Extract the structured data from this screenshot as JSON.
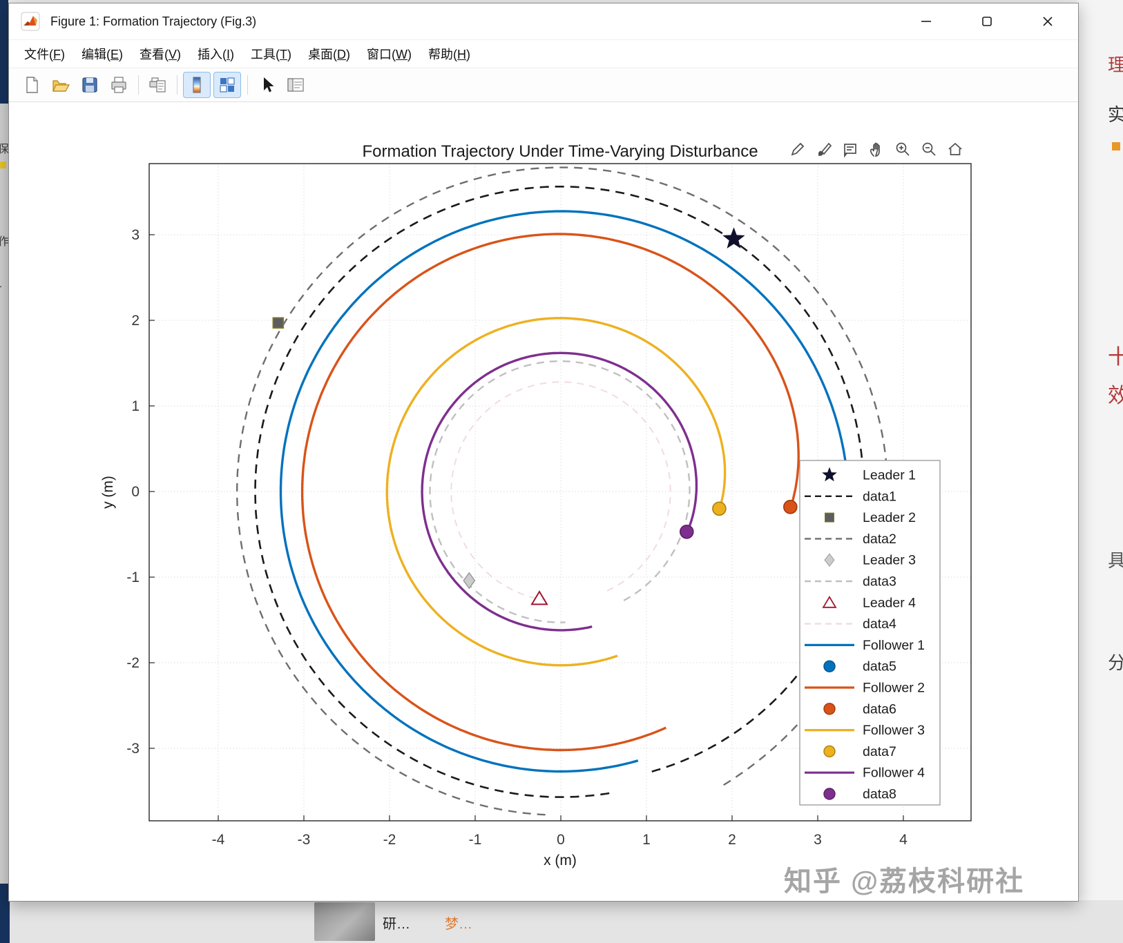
{
  "window": {
    "title": "Figure 1: Formation Trajectory (Fig.3)",
    "menu": [
      "文件(F)",
      "编辑(E)",
      "查看(V)",
      "插入(I)",
      "工具(T)",
      "桌面(D)",
      "窗口(W)",
      "帮助(H)"
    ],
    "toolbar_icons": [
      "new-file",
      "open-file",
      "save",
      "print",
      "print-preview",
      "colormap-editor",
      "plot-browser",
      "edit-cursor",
      "property-panel"
    ]
  },
  "figure_tools": [
    "edit-plot",
    "brush-data",
    "data-tips",
    "pan",
    "zoom-in",
    "zoom-out",
    "restore-view"
  ],
  "chart_data": {
    "type": "line",
    "title": "Formation Trajectory Under Time-Varying Disturbance",
    "xlabel": "x (m)",
    "ylabel": "y (m)",
    "xlim": [
      -4.8,
      4.8
    ],
    "ylim": [
      -3.85,
      3.85
    ],
    "xticks": [
      -4,
      -3,
      -2,
      -1,
      0,
      1,
      2,
      3,
      4
    ],
    "yticks": [
      -3,
      -2,
      -1,
      0,
      1,
      2,
      3
    ],
    "grid": true,
    "legend_position": "right-inside",
    "series": [
      {
        "name": "data2",
        "role": "leader2-reference-circle",
        "color": "#6e6e6e",
        "style": "dashed",
        "dash": "12 9",
        "width": 2.4,
        "center": [
          0,
          0
        ],
        "theta_start": -61,
        "theta_end": 268,
        "r_start": 3.92,
        "r_end": 3.78,
        "k": 1.2
      },
      {
        "name": "data1",
        "role": "leader1-reference-circle",
        "color": "#1a1a1a",
        "style": "dashed",
        "dash": "13 9",
        "width": 2.6,
        "center": [
          0,
          0
        ],
        "theta_start": -72,
        "theta_end": 280,
        "r_start": 3.44,
        "r_end": 3.57,
        "k": 1.0
      },
      {
        "name": "data4",
        "role": "leader4-reference-circle",
        "color": "#f0dce2",
        "style": "dashed",
        "dash": "10 8",
        "width": 2.0,
        "center": [
          0,
          0
        ],
        "theta_start": -65,
        "theta_end": 262,
        "r_start": 1.28,
        "r_end": 1.28,
        "k": 0.5
      },
      {
        "name": "data3",
        "role": "leader3-reference-circle",
        "color": "#c0c0c0",
        "style": "dashed",
        "dash": "11 8",
        "width": 2.4,
        "center": [
          0,
          0
        ],
        "theta_start": -60,
        "theta_end": 272,
        "r_start": 1.47,
        "r_end": 1.53,
        "k": 0.8
      },
      {
        "name": "Follower 1",
        "color": "#0072BD",
        "style": "solid",
        "width": 3.4,
        "center": [
          0,
          0
        ],
        "theta_start": -15,
        "theta_end": 286,
        "r_start": 3.42,
        "r_end": 3.27,
        "k": 2.0
      },
      {
        "name": "Follower 2",
        "color": "#D95319",
        "style": "solid",
        "width": 3.4,
        "center": [
          0,
          0
        ],
        "theta_start": -4,
        "theta_end": 294,
        "r_start": 2.69,
        "r_end": 3.02,
        "k": 2.0
      },
      {
        "name": "Follower 3",
        "color": "#EDB120",
        "style": "solid",
        "width": 3.4,
        "center": [
          0,
          0
        ],
        "theta_start": -7,
        "theta_end": 289,
        "r_start": 1.86,
        "r_end": 2.03,
        "k": 2.2
      },
      {
        "name": "Follower 4",
        "color": "#7E2F8E",
        "style": "solid",
        "width": 3.4,
        "center": [
          0,
          0
        ],
        "theta_start": -18,
        "theta_end": 283,
        "r_start": 1.55,
        "r_end": 1.62,
        "k": 2.0
      }
    ],
    "markers": [
      {
        "name": "Leader 1",
        "shape": "star",
        "x": 2.02,
        "y": 2.95,
        "fill": "#10102e",
        "stroke": "#10102e",
        "size": 15
      },
      {
        "name": "Leader 2",
        "shape": "square",
        "x": -3.3,
        "y": 1.97,
        "fill": "#5d5d5d",
        "stroke": "#857a25",
        "size": 15
      },
      {
        "name": "Leader 3",
        "shape": "diamond",
        "x": -1.07,
        "y": -1.04,
        "fill": "#cccccc",
        "stroke": "#9d9d9d",
        "size": 18
      },
      {
        "name": "Leader 4",
        "shape": "triangle",
        "x": -0.25,
        "y": -1.25,
        "fill": "none",
        "stroke": "#a2142f",
        "size": 20
      },
      {
        "name": "data5",
        "shape": "circle",
        "x": 3.3,
        "y": -0.9,
        "fill": "#0072BD",
        "stroke": "#00538a",
        "size": 9.5
      },
      {
        "name": "data6",
        "shape": "circle",
        "x": 2.68,
        "y": -0.18,
        "fill": "#D95319",
        "stroke": "#9c3a10",
        "size": 9.5
      },
      {
        "name": "data7",
        "shape": "circle",
        "x": 1.85,
        "y": -0.2,
        "fill": "#EDB120",
        "stroke": "#aa7e0e",
        "size": 9.5
      },
      {
        "name": "data8",
        "shape": "circle",
        "x": 1.47,
        "y": -0.47,
        "fill": "#7E2F8E",
        "stroke": "#5a2066",
        "size": 9.5
      }
    ],
    "legend": [
      {
        "glyph": "star",
        "color": "#10102e",
        "label": "Leader 1"
      },
      {
        "glyph": "dash",
        "color": "#1a1a1a",
        "label": "data1"
      },
      {
        "glyph": "square",
        "color": "#5d5d5d",
        "stroke": "#857a25",
        "label": "Leader 2"
      },
      {
        "glyph": "dash",
        "color": "#6e6e6e",
        "label": "data2"
      },
      {
        "glyph": "diamond",
        "color": "#cccccc",
        "stroke": "#9d9d9d",
        "label": "Leader 3"
      },
      {
        "glyph": "dash",
        "color": "#c0c0c0",
        "label": "data3"
      },
      {
        "glyph": "triangle",
        "color": "none",
        "stroke": "#a2142f",
        "label": "Leader 4"
      },
      {
        "glyph": "dash",
        "color": "#f0dce2",
        "label": "data4"
      },
      {
        "glyph": "line",
        "color": "#0072BD",
        "label": "Follower 1"
      },
      {
        "glyph": "circle",
        "color": "#0072BD",
        "stroke": "#00538a",
        "label": "data5"
      },
      {
        "glyph": "line",
        "color": "#D95319",
        "label": "Follower 2"
      },
      {
        "glyph": "circle",
        "color": "#D95319",
        "stroke": "#9c3a10",
        "label": "data6"
      },
      {
        "glyph": "line",
        "color": "#EDB120",
        "label": "Follower 3"
      },
      {
        "glyph": "circle",
        "color": "#EDB120",
        "stroke": "#aa7e0e",
        "label": "data7"
      },
      {
        "glyph": "line",
        "color": "#7E2F8E",
        "label": "Follower 4"
      },
      {
        "glyph": "circle",
        "color": "#7E2F8E",
        "stroke": "#5a2066",
        "label": "data8"
      }
    ]
  },
  "watermark": "知乎 @荔枝科研社",
  "edges": {
    "left_fragments": [
      "保",
      "作",
      "r"
    ],
    "right_fragments": [
      "理",
      "实",
      "十",
      "效",
      "具",
      "分"
    ],
    "bottom_fragments": [
      "研…",
      "梦…"
    ]
  }
}
